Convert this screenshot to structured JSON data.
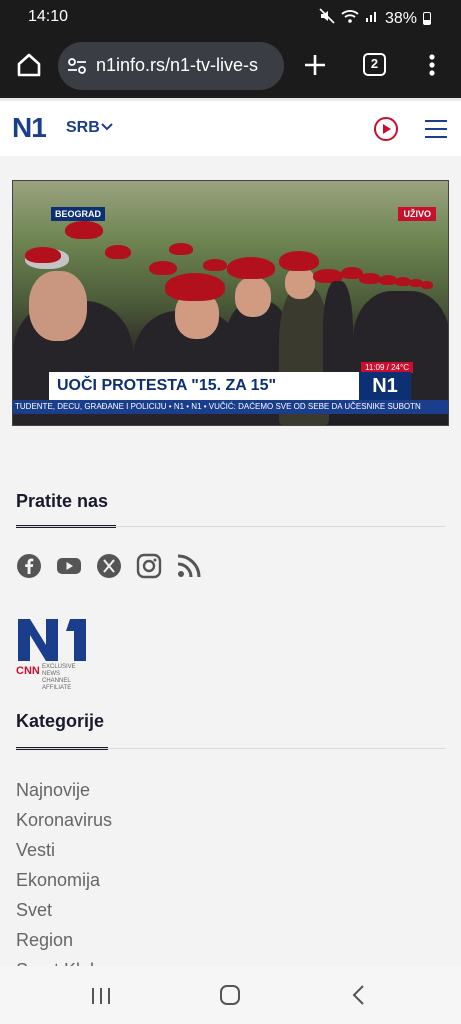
{
  "status_bar": {
    "time": "14:10",
    "battery": "38%"
  },
  "browser": {
    "url": "n1info.rs/n1-tv-live-s",
    "tab_count": "2"
  },
  "site_header": {
    "logo": "N1",
    "region": "SRB"
  },
  "video": {
    "location_tag": "BEOGRAD",
    "live_tag": "UŽIVO",
    "time_weather": "11:09 / 24°C",
    "headline": "UOČI PROTESTA \"15. ZA 15\"",
    "channel": "N1",
    "ticker": "TUDENTE, DECU, GRAĐANE I POLICIJU • N1 • N1 • VUČIĆ: DAĆEMO SVE OD SEBE DA UČESNIKE SUBOTN"
  },
  "footer": {
    "follow_title": "Pratite nas",
    "social_icons": [
      "facebook-icon",
      "youtube-icon",
      "x-icon",
      "instagram-icon",
      "rss-icon"
    ],
    "logo_cnn": "CNN",
    "logo_affiliate": "EXCLUSIVE NEWS CHANNEL AFFILIATE",
    "categories_title": "Kategorije",
    "categories": [
      "Najnovije",
      "Koronavirus",
      "Vesti",
      "Ekonomija",
      "Svet",
      "Region",
      "Sport Klub"
    ]
  },
  "colors": {
    "brand_blue": "#1a3e8c",
    "brand_red": "#c8102e"
  }
}
